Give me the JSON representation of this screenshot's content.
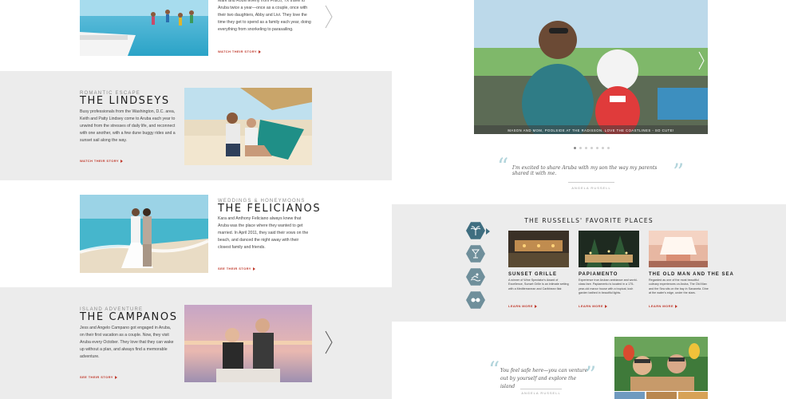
{
  "stories": [
    {
      "kicker": "",
      "title": "",
      "body": "Mark and Robin Everly from Frisco, TX travel to Aruba twice a year—once as a couple, once with their two daughters, Abby and Livi. They love the time they get to spend as a family each year, doing everything from snorkeling to parasailing.",
      "cta": "WATCH THEIR STORY"
    },
    {
      "kicker": "ROMANTIC ESCAPE",
      "title": "THE LINDSEYS",
      "body": "Busy professionals from the Washington, D.C. area, Keith and Patty Lindsey come to Aruba each year to unwind from the stresses of daily life, and reconnect with one another, with a few dune buggy rides and a sunset sail along the way.",
      "cta": "WATCH THEIR STORY"
    },
    {
      "kicker": "WEDDINGS & HONEYMOONS",
      "title": "THE FELICIANOS",
      "body": "Kara and Anthony Feliciano always knew that Aruba was the place where they wanted to get married. In April 2011, they said their vows on the beach, and danced the night away with their closest family and friends.",
      "cta": "SEE THEIR STORY"
    },
    {
      "kicker": "ISLAND ADVENTURE",
      "title": "THE CAMPANOS",
      "body": "Jess and Angelo Campano got engaged in Aruba, on their first vacation as a couple. Now, they visit Aruba every October. They love that they can wake up without a plan, and always find a memorable adventure.",
      "cta": "SEE THEIR STORY"
    }
  ],
  "slideshow": {
    "caption": "MASON AND MOM, POOLSIDE AT THE RADISSON. LOVE THE COASTLINES - SO CUTE!",
    "dots": 7,
    "active_dot": 0
  },
  "quote1": {
    "text": "I'm excited to share Aruba with my son the way my parents shared it with me.",
    "attribution": "ANGELA RUSSELL"
  },
  "favorites": {
    "title": "THE RUSSELLS' FAVORITE PLACES",
    "categories": [
      "palm-tree-icon",
      "cocktail-icon",
      "swimmer-icon",
      "sunglasses-icon"
    ],
    "places": [
      {
        "name": "SUNSET GRILLE",
        "desc": "A winner of Wine Spectator's Award of Excellence, Sunset Grille is an intimate setting with a Mediterranean and Caribbean flair.",
        "cta": "LEARN MORE"
      },
      {
        "name": "PAPIAMENTO",
        "desc": "Experience true Aruban ambiance and world-class fare. Papiamento is located in a 175-year-old manor house with a tropical, lush garden bathed in beautiful lights.",
        "cta": "LEARN MORE"
      },
      {
        "name": "THE OLD MAN AND THE SEA",
        "desc": "Regarded as one of the most beautiful culinary experiences on Aruba, The Old Man and the Sea sits on the bay in Savaneta. Dine at the water's edge, under the stars.",
        "cta": "LEARN MORE"
      }
    ]
  },
  "quote2": {
    "text": "You feel safe here—you can venture out by yourself and explore the island",
    "attribution": "ANGELA RUSSELL"
  },
  "colors": {
    "accent_red": "#c0392b",
    "quote_teal": "#b3d5dc",
    "hex_blue": "#3f6e80",
    "band_gray": "#ececec"
  }
}
